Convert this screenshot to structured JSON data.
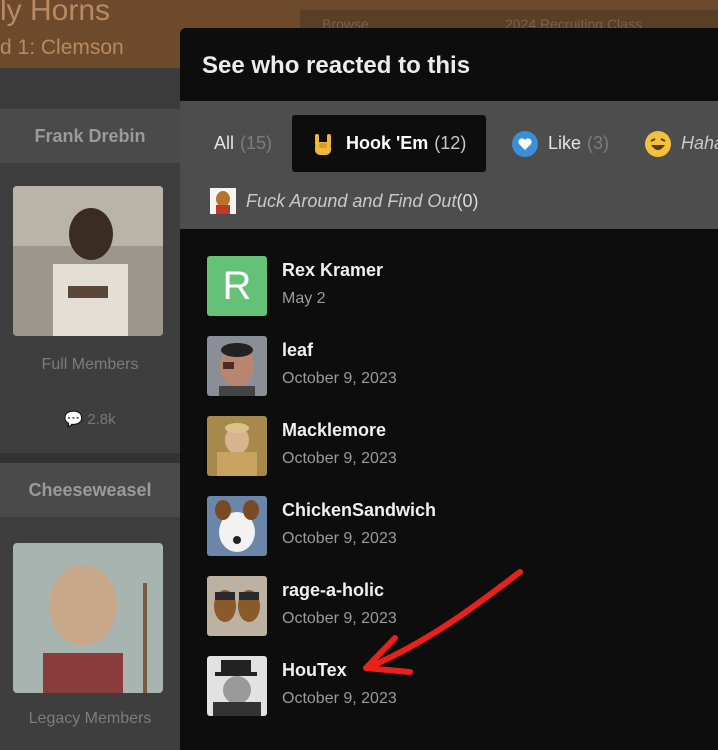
{
  "background": {
    "page_title": "ly Horns",
    "page_subtitle": "d 1: Clemson",
    "nav_browse": "Browse",
    "nav_class": "2024 Recruiting Class",
    "sidebar": [
      {
        "name": "Frank Drebin",
        "role": "Full Members",
        "count": "2.8k"
      },
      {
        "name": "Cheeseweasel",
        "role": "Legacy Members"
      }
    ]
  },
  "modal": {
    "title": "See who reacted to this",
    "tabs": [
      {
        "label": "All",
        "count": "(15)"
      },
      {
        "label": "Hook 'Em",
        "count": "(12)",
        "icon": "hook-em-hand-icon"
      },
      {
        "label": "Like",
        "count": "(3)",
        "icon": "heart-like-icon"
      },
      {
        "label": "Haha",
        "icon": "laughing-face-icon"
      },
      {
        "label": "Fuck Around and Find Out",
        "count": "(0)",
        "icon": "faf-character-icon"
      }
    ],
    "members": [
      {
        "name": "Rex Kramer",
        "date": "May 2",
        "avatar_letter": "R"
      },
      {
        "name": "leaf",
        "date": "October 9, 2023"
      },
      {
        "name": "Macklemore",
        "date": "October 9, 2023"
      },
      {
        "name": "ChickenSandwich",
        "date": "October 9, 2023"
      },
      {
        "name": "rage-a-holic",
        "date": "October 9, 2023"
      },
      {
        "name": "HouTex",
        "date": "October 9, 2023"
      }
    ]
  },
  "colors": {
    "modal_bg": "#0d0d0d",
    "tabbar_bg": "#4d4d4d",
    "arrow": "#e8211d",
    "letter_avatar": "#66c178"
  }
}
